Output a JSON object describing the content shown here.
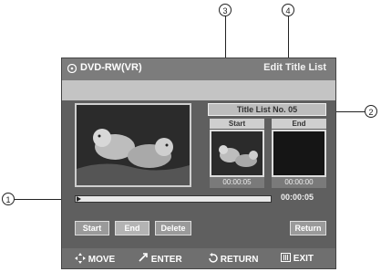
{
  "header": {
    "title": "DVD-RW(VR)",
    "screen_name": "Edit Title List"
  },
  "panel": {
    "title_list_no": "Title List No. 05",
    "start_label": "Start",
    "end_label": "End",
    "start_time": "00:00:05",
    "end_time": "00:00:00",
    "playback_time": "00:00:05"
  },
  "buttons": {
    "start": "Start",
    "end": "End",
    "delete": "Delete",
    "return": "Return"
  },
  "footer": {
    "move": "MOVE",
    "enter": "ENTER",
    "return": "RETURN",
    "exit": "EXIT"
  },
  "callouts": {
    "c1": "1",
    "c2": "2",
    "c3": "3",
    "c4": "4"
  }
}
